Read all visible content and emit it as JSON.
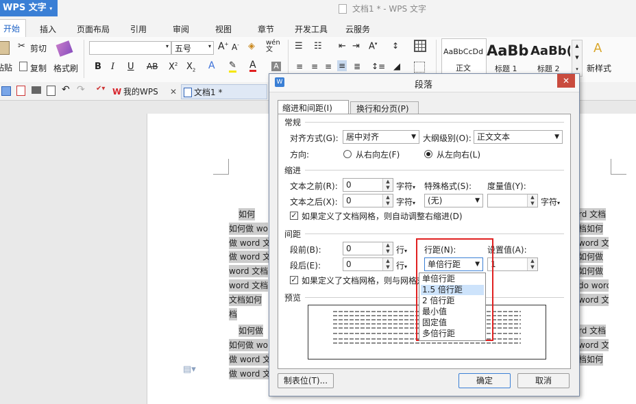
{
  "app": {
    "button": "WPS 文字",
    "window_title": "文档1 * - WPS 文字"
  },
  "menu": [
    "开始",
    "插入",
    "页面布局",
    "引用",
    "审阅",
    "视图",
    "章节",
    "开发工具",
    "云服务"
  ],
  "ribbon": {
    "cut": "剪切",
    "copy": "复制",
    "paste": "粘贴",
    "format_painter": "格式刷",
    "font_size": "五号",
    "styles": [
      {
        "sample": "AaBbCcDd",
        "name": "正文"
      },
      {
        "sample": "AaBb",
        "name": "标题 1"
      },
      {
        "sample": "AaBb(",
        "name": "标题 2"
      }
    ],
    "new_style": "新样式"
  },
  "tabs": {
    "mywps": "我的WPS",
    "doc": "文档1 *"
  },
  "document": {
    "left_lines": [
      "如何",
      "如何做 wo",
      "做 word 文",
      "做 word 文",
      "word 文档",
      "word 文档",
      "文档如何",
      "档",
      "如何做",
      "如何做 wo",
      "做 word 文",
      "做 word 文"
    ],
    "right_lines": [
      "rd 文档",
      "档如何",
      "word 文",
      "如何做",
      "如何做",
      "do word",
      "word 文",
      "rd 文档",
      "word 文",
      "档如何"
    ]
  },
  "dialog": {
    "title": "段落",
    "tab_indent": "缩进和间距(I)",
    "tab_break": "换行和分页(P)",
    "general": {
      "section": "常规",
      "align_label": "对齐方式(G):",
      "align_value": "居中对齐",
      "outline_label": "大纲级别(O):",
      "outline_value": "正文文本",
      "direction_label": "方向:",
      "rtl": "从右向左(F)",
      "ltr": "从左向右(L)"
    },
    "indent": {
      "section": "缩进",
      "before_label": "文本之前(R):",
      "before_value": "0",
      "after_label": "文本之后(X):",
      "after_value": "0",
      "unit": "字符",
      "special_label": "特殊格式(S):",
      "special_value": "(无)",
      "measure_label": "度量值(Y):",
      "measure_unit": "字符",
      "auto_right": "如果定义了文档网格，则自动调整右缩进(D)"
    },
    "spacing": {
      "section": "间距",
      "before_label": "段前(B):",
      "before_value": "0",
      "after_label": "段后(E):",
      "after_value": "0",
      "unit": "行",
      "line_label": "行距(N):",
      "line_value": "单倍行距",
      "setting_label": "设置值(A):",
      "setting_value": "1",
      "snap_grid": "如果定义了文档网格，则与网格对"
    },
    "line_options": [
      "单倍行距",
      "1.5 倍行距",
      "2 倍行距",
      "最小值",
      "固定值",
      "多倍行距"
    ],
    "preview_label": "预览",
    "tabs_button": "制表位(T)...",
    "ok": "确定",
    "cancel": "取消"
  }
}
